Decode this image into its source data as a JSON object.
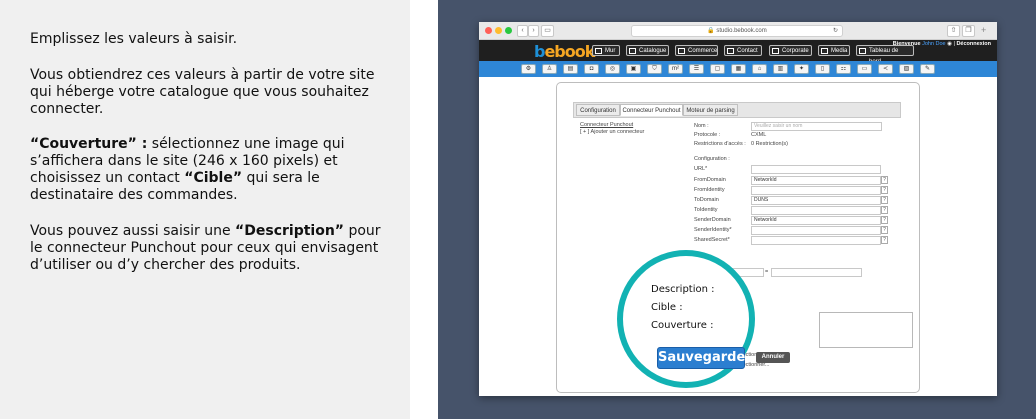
{
  "instructions": {
    "p1": "Emplissez les valeurs à saisir.",
    "p2": "Vous obtiendrez ces valeurs à partir de votre site qui héberge votre catalogue  que vous souhaitez connecter.",
    "p3_bold1": "“Couverture” :",
    "p3_text1": " sélectionnez une image qui s’affichera dans le site (246 x 160 pixels) et choisissez un contact ",
    "p3_bold2": "“Cible”",
    "p3_text2": " qui sera le destinataire des commandes.",
    "p4_text1": "Vous pouvez aussi saisir une ",
    "p4_bold": "“Description”",
    "p4_text2": " pour le connecteur Punchout pour ceux qui envisagent d’utiliser ou d’y chercher des produits."
  },
  "browser": {
    "url": "studio.bebook.com",
    "logo_b": "b",
    "logo_ebook": "ebook",
    "welcome": "Bienvenue",
    "welcome_name": "John Doe",
    "logout": "Déconnexion",
    "nav": [
      "Mur",
      "Catalogue",
      "Commerce",
      "Contact",
      "Corporate",
      "Media",
      "Tableau de bord"
    ]
  },
  "colors": {
    "accent": "#2e86d6",
    "callout": "#12b2b3",
    "logo_b": "#1e90d8",
    "logo_rest": "#f5a623"
  },
  "form": {
    "tabs": [
      "Configuration",
      "Connecteur Punchout",
      "Moteur de parsing"
    ],
    "connector_title": "Connecteur Punchout",
    "add_connector": "[ + ] Ajouter un connecteur",
    "nom_label": "Nom :",
    "nom_placeholder": "Veuillez saisir un nom",
    "protocole_label": "Protocole :",
    "protocole_value": "CXML",
    "restrictions_label": "Restrictions d'accès :",
    "restrictions_value": "0 Restriction(s)",
    "configuration_label": "Configuration :",
    "fields": [
      {
        "label": "URL*",
        "value": ""
      },
      {
        "label": "FromDomain",
        "value": "NetworkId"
      },
      {
        "label": "FromIdentity",
        "value": ""
      },
      {
        "label": "ToDomain",
        "value": "DUNS"
      },
      {
        "label": "ToIdentity",
        "value": ""
      },
      {
        "label": "SenderDomain",
        "value": "NetworkId"
      },
      {
        "label": "SenderIdentity*",
        "value": ""
      },
      {
        "label": "SharedSecret*",
        "value": ""
      }
    ],
    "equals": "=",
    "select1": "...ectionner...",
    "select2": "...ectionner...",
    "save": "Sauvegarde",
    "cancel": "Annuler"
  },
  "callout": {
    "description": "Description :",
    "cible": "Cible :",
    "couverture": "Couverture :"
  }
}
